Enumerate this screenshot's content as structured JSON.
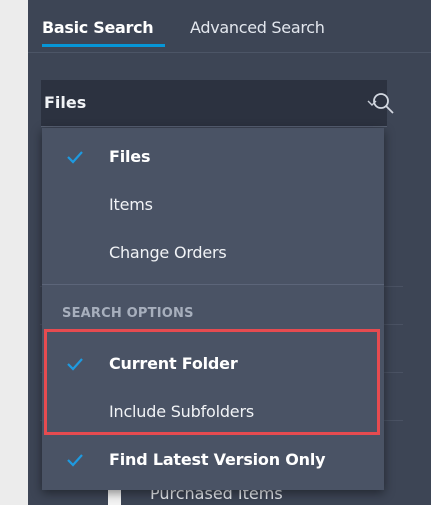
{
  "tabs": {
    "basic": "Basic Search",
    "advanced": "Advanced Search"
  },
  "search": {
    "type_value": "Files",
    "icons": {
      "dropdown": "chevron-down-icon",
      "search": "search-icon"
    }
  },
  "dropdown": {
    "items": [
      {
        "label": "Files",
        "checked": true
      },
      {
        "label": "Items",
        "checked": false
      },
      {
        "label": "Change Orders",
        "checked": false
      }
    ],
    "section_title": "SEARCH OPTIONS",
    "options": [
      {
        "label": "Current Folder",
        "checked": true
      },
      {
        "label": "Include Subfolders",
        "checked": false
      },
      {
        "label": "Find Latest Version Only",
        "checked": true
      }
    ]
  },
  "background": {
    "visible_item": "Purchased Items"
  },
  "colors": {
    "accent": "#0696d7",
    "highlight": "#e64b50",
    "panel": "#3d4555",
    "menu": "#4a5365"
  }
}
